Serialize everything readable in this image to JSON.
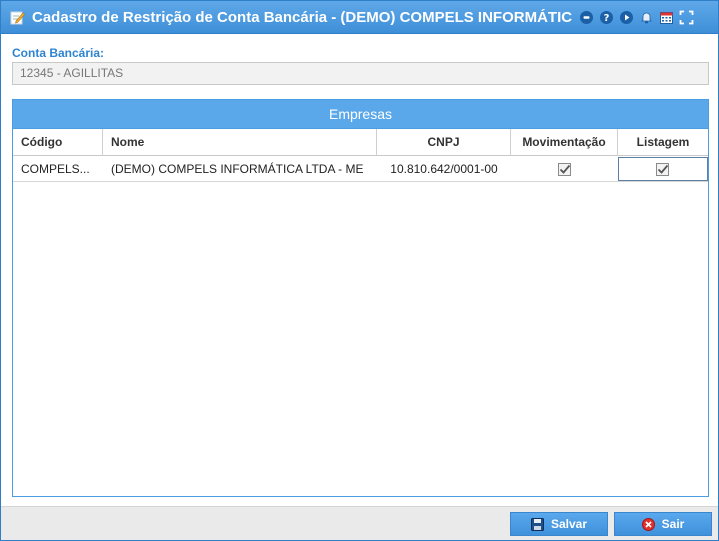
{
  "window": {
    "title": "Cadastro de Restrição de Conta Bancária - (DEMO) COMPELS INFORMÁTIC...",
    "tools": [
      "minimize-icon",
      "help-icon",
      "play-icon",
      "bell-icon",
      "calendar-icon",
      "fullscreen-icon"
    ]
  },
  "form": {
    "account_label": "Conta Bancária:",
    "account_value": "12345 - AGILLITAS"
  },
  "companies": {
    "panel_title": "Empresas",
    "columns": [
      "Código",
      "Nome",
      "CNPJ",
      "Movimentação",
      "Listagem"
    ],
    "rows": [
      {
        "codigo": "COMPELS...",
        "nome": "(DEMO) COMPELS INFORMÁTICA LTDA - ME",
        "cnpj": "10.810.642/0001-00",
        "movimentacao": true,
        "listagem": true
      }
    ]
  },
  "footer": {
    "save_label": "Salvar",
    "exit_label": "Sair"
  },
  "colors": {
    "accent": "#4a9de0",
    "title_bar": "#3f8fd8",
    "label": "#2e84d0",
    "exit_icon": "#e03030"
  }
}
